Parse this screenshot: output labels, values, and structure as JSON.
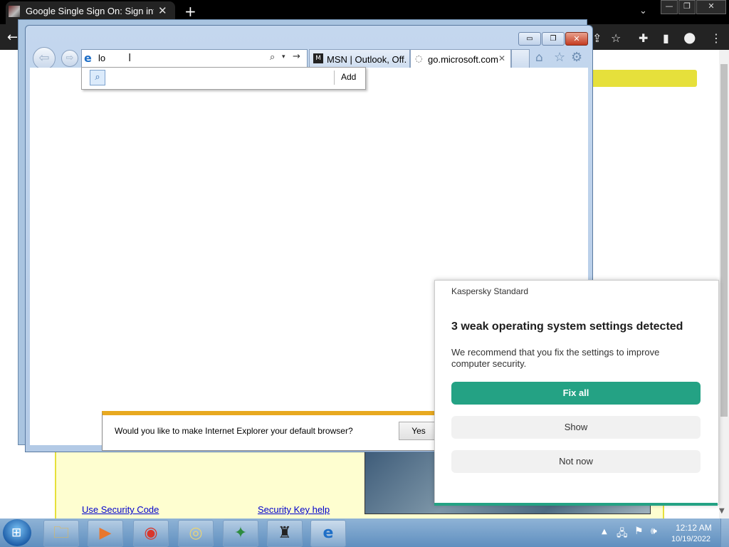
{
  "chrome": {
    "tab_title": "Google Single Sign On: Sign into",
    "tab_close": "✕",
    "new_tab": "+",
    "tab_search": "⌄",
    "window": {
      "minimize": "—",
      "restore": "❐",
      "close": "✕"
    },
    "back": "←",
    "toolbar_icons": {
      "share": "⇪",
      "bookmark": "☆",
      "extensions": "✚",
      "sidebar": "▮",
      "profile": "●",
      "menu": "⋮"
    }
  },
  "page": {
    "links": {
      "security_code": "Use Security Code",
      "security_key": "Security Key help"
    }
  },
  "ie": {
    "caption": {
      "minimize": "▭",
      "restore": "❐",
      "close": "✕"
    },
    "back": "⇦",
    "forward": "⇨",
    "address": {
      "icon": "e",
      "value": "lo",
      "caret": "I",
      "search_icon": "⌕",
      "dropdown_icon": "▾",
      "go_icon": "→"
    },
    "tabs": [
      {
        "label": "MSN | Outlook, Off...",
        "icon": "M"
      },
      {
        "label": "go.microsoft.com",
        "icon": "◌",
        "close": "✕"
      }
    ],
    "commands": {
      "home": "⌂",
      "favorites": "☆",
      "tools": "⚙"
    },
    "suggest": {
      "icon": "⌕",
      "add": "Add"
    },
    "notification": {
      "text": "Would you like to make Internet Explorer your default browser?",
      "yes": "Yes"
    }
  },
  "kaspersky": {
    "app_name": "Kaspersky Standard",
    "title": "3 weak operating system settings detected",
    "body": "We recommend that you fix the settings to improve computer security.",
    "buttons": {
      "fix_all": "Fix all",
      "show": "Show",
      "not_now": "Not now"
    },
    "accent": "#24a284"
  },
  "taskbar": {
    "start_logo": "⊞",
    "apps": [
      {
        "name": "file-explorer",
        "glyph": "🗀"
      },
      {
        "name": "media-player",
        "glyph": "▶"
      },
      {
        "name": "chrome",
        "glyph": "◉"
      },
      {
        "name": "dvd-maker",
        "glyph": "◎"
      },
      {
        "name": "pinball",
        "glyph": "✦"
      },
      {
        "name": "game-console",
        "glyph": "♜"
      },
      {
        "name": "internet-explorer",
        "glyph": "e"
      }
    ],
    "tray": {
      "arrow": "▲",
      "network": "🖧",
      "flag": "⚑",
      "volume": "🕪"
    },
    "clock": {
      "time": "12:12 AM",
      "date": "10/19/2022"
    }
  }
}
